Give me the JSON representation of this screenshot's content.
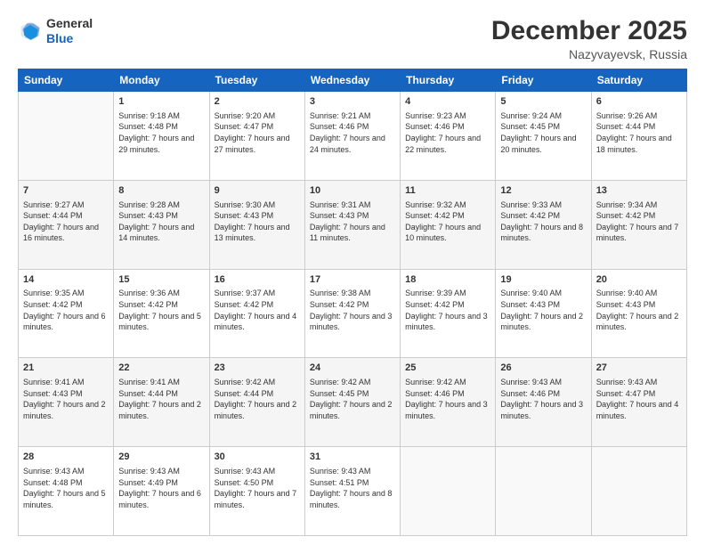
{
  "logo": {
    "line1": "General",
    "line2": "Blue"
  },
  "title": "December 2025",
  "location": "Nazyvayevsk, Russia",
  "days_header": [
    "Sunday",
    "Monday",
    "Tuesday",
    "Wednesday",
    "Thursday",
    "Friday",
    "Saturday"
  ],
  "weeks": [
    [
      {
        "day": "",
        "sunrise": "",
        "sunset": "",
        "daylight": ""
      },
      {
        "day": "1",
        "sunrise": "Sunrise: 9:18 AM",
        "sunset": "Sunset: 4:48 PM",
        "daylight": "Daylight: 7 hours and 29 minutes."
      },
      {
        "day": "2",
        "sunrise": "Sunrise: 9:20 AM",
        "sunset": "Sunset: 4:47 PM",
        "daylight": "Daylight: 7 hours and 27 minutes."
      },
      {
        "day": "3",
        "sunrise": "Sunrise: 9:21 AM",
        "sunset": "Sunset: 4:46 PM",
        "daylight": "Daylight: 7 hours and 24 minutes."
      },
      {
        "day": "4",
        "sunrise": "Sunrise: 9:23 AM",
        "sunset": "Sunset: 4:46 PM",
        "daylight": "Daylight: 7 hours and 22 minutes."
      },
      {
        "day": "5",
        "sunrise": "Sunrise: 9:24 AM",
        "sunset": "Sunset: 4:45 PM",
        "daylight": "Daylight: 7 hours and 20 minutes."
      },
      {
        "day": "6",
        "sunrise": "Sunrise: 9:26 AM",
        "sunset": "Sunset: 4:44 PM",
        "daylight": "Daylight: 7 hours and 18 minutes."
      }
    ],
    [
      {
        "day": "7",
        "sunrise": "Sunrise: 9:27 AM",
        "sunset": "Sunset: 4:44 PM",
        "daylight": "Daylight: 7 hours and 16 minutes."
      },
      {
        "day": "8",
        "sunrise": "Sunrise: 9:28 AM",
        "sunset": "Sunset: 4:43 PM",
        "daylight": "Daylight: 7 hours and 14 minutes."
      },
      {
        "day": "9",
        "sunrise": "Sunrise: 9:30 AM",
        "sunset": "Sunset: 4:43 PM",
        "daylight": "Daylight: 7 hours and 13 minutes."
      },
      {
        "day": "10",
        "sunrise": "Sunrise: 9:31 AM",
        "sunset": "Sunset: 4:43 PM",
        "daylight": "Daylight: 7 hours and 11 minutes."
      },
      {
        "day": "11",
        "sunrise": "Sunrise: 9:32 AM",
        "sunset": "Sunset: 4:42 PM",
        "daylight": "Daylight: 7 hours and 10 minutes."
      },
      {
        "day": "12",
        "sunrise": "Sunrise: 9:33 AM",
        "sunset": "Sunset: 4:42 PM",
        "daylight": "Daylight: 7 hours and 8 minutes."
      },
      {
        "day": "13",
        "sunrise": "Sunrise: 9:34 AM",
        "sunset": "Sunset: 4:42 PM",
        "daylight": "Daylight: 7 hours and 7 minutes."
      }
    ],
    [
      {
        "day": "14",
        "sunrise": "Sunrise: 9:35 AM",
        "sunset": "Sunset: 4:42 PM",
        "daylight": "Daylight: 7 hours and 6 minutes."
      },
      {
        "day": "15",
        "sunrise": "Sunrise: 9:36 AM",
        "sunset": "Sunset: 4:42 PM",
        "daylight": "Daylight: 7 hours and 5 minutes."
      },
      {
        "day": "16",
        "sunrise": "Sunrise: 9:37 AM",
        "sunset": "Sunset: 4:42 PM",
        "daylight": "Daylight: 7 hours and 4 minutes."
      },
      {
        "day": "17",
        "sunrise": "Sunrise: 9:38 AM",
        "sunset": "Sunset: 4:42 PM",
        "daylight": "Daylight: 7 hours and 3 minutes."
      },
      {
        "day": "18",
        "sunrise": "Sunrise: 9:39 AM",
        "sunset": "Sunset: 4:42 PM",
        "daylight": "Daylight: 7 hours and 3 minutes."
      },
      {
        "day": "19",
        "sunrise": "Sunrise: 9:40 AM",
        "sunset": "Sunset: 4:43 PM",
        "daylight": "Daylight: 7 hours and 2 minutes."
      },
      {
        "day": "20",
        "sunrise": "Sunrise: 9:40 AM",
        "sunset": "Sunset: 4:43 PM",
        "daylight": "Daylight: 7 hours and 2 minutes."
      }
    ],
    [
      {
        "day": "21",
        "sunrise": "Sunrise: 9:41 AM",
        "sunset": "Sunset: 4:43 PM",
        "daylight": "Daylight: 7 hours and 2 minutes."
      },
      {
        "day": "22",
        "sunrise": "Sunrise: 9:41 AM",
        "sunset": "Sunset: 4:44 PM",
        "daylight": "Daylight: 7 hours and 2 minutes."
      },
      {
        "day": "23",
        "sunrise": "Sunrise: 9:42 AM",
        "sunset": "Sunset: 4:44 PM",
        "daylight": "Daylight: 7 hours and 2 minutes."
      },
      {
        "day": "24",
        "sunrise": "Sunrise: 9:42 AM",
        "sunset": "Sunset: 4:45 PM",
        "daylight": "Daylight: 7 hours and 2 minutes."
      },
      {
        "day": "25",
        "sunrise": "Sunrise: 9:42 AM",
        "sunset": "Sunset: 4:46 PM",
        "daylight": "Daylight: 7 hours and 3 minutes."
      },
      {
        "day": "26",
        "sunrise": "Sunrise: 9:43 AM",
        "sunset": "Sunset: 4:46 PM",
        "daylight": "Daylight: 7 hours and 3 minutes."
      },
      {
        "day": "27",
        "sunrise": "Sunrise: 9:43 AM",
        "sunset": "Sunset: 4:47 PM",
        "daylight": "Daylight: 7 hours and 4 minutes."
      }
    ],
    [
      {
        "day": "28",
        "sunrise": "Sunrise: 9:43 AM",
        "sunset": "Sunset: 4:48 PM",
        "daylight": "Daylight: 7 hours and 5 minutes."
      },
      {
        "day": "29",
        "sunrise": "Sunrise: 9:43 AM",
        "sunset": "Sunset: 4:49 PM",
        "daylight": "Daylight: 7 hours and 6 minutes."
      },
      {
        "day": "30",
        "sunrise": "Sunrise: 9:43 AM",
        "sunset": "Sunset: 4:50 PM",
        "daylight": "Daylight: 7 hours and 7 minutes."
      },
      {
        "day": "31",
        "sunrise": "Sunrise: 9:43 AM",
        "sunset": "Sunset: 4:51 PM",
        "daylight": "Daylight: 7 hours and 8 minutes."
      },
      {
        "day": "",
        "sunrise": "",
        "sunset": "",
        "daylight": ""
      },
      {
        "day": "",
        "sunrise": "",
        "sunset": "",
        "daylight": ""
      },
      {
        "day": "",
        "sunrise": "",
        "sunset": "",
        "daylight": ""
      }
    ]
  ]
}
